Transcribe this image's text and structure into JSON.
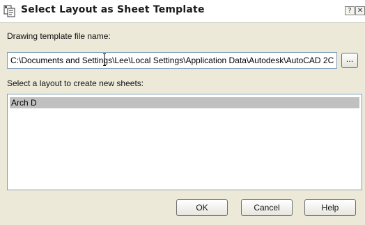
{
  "window": {
    "title": "Select Layout as Sheet Template",
    "help_glyph": "?",
    "close_glyph": "✕"
  },
  "template": {
    "label": "Drawing template file name:",
    "path": "C:\\Documents and Settings\\Lee\\Local Settings\\Application Data\\Autodesk\\AutoCAD 2C",
    "browse_label": "..."
  },
  "layouts": {
    "label": "Select a layout to create new sheets:",
    "items": [
      "Arch D"
    ],
    "selected_index": 0
  },
  "buttons": {
    "ok": "OK",
    "cancel": "Cancel",
    "help": "Help"
  },
  "colors": {
    "dialog_bg": "#ece9d8",
    "selection": "#c0c0c0",
    "field_border": "#7f9db9"
  },
  "icons": {
    "app": "sheet-set-icon",
    "cursor": "text-cursor-icon"
  }
}
